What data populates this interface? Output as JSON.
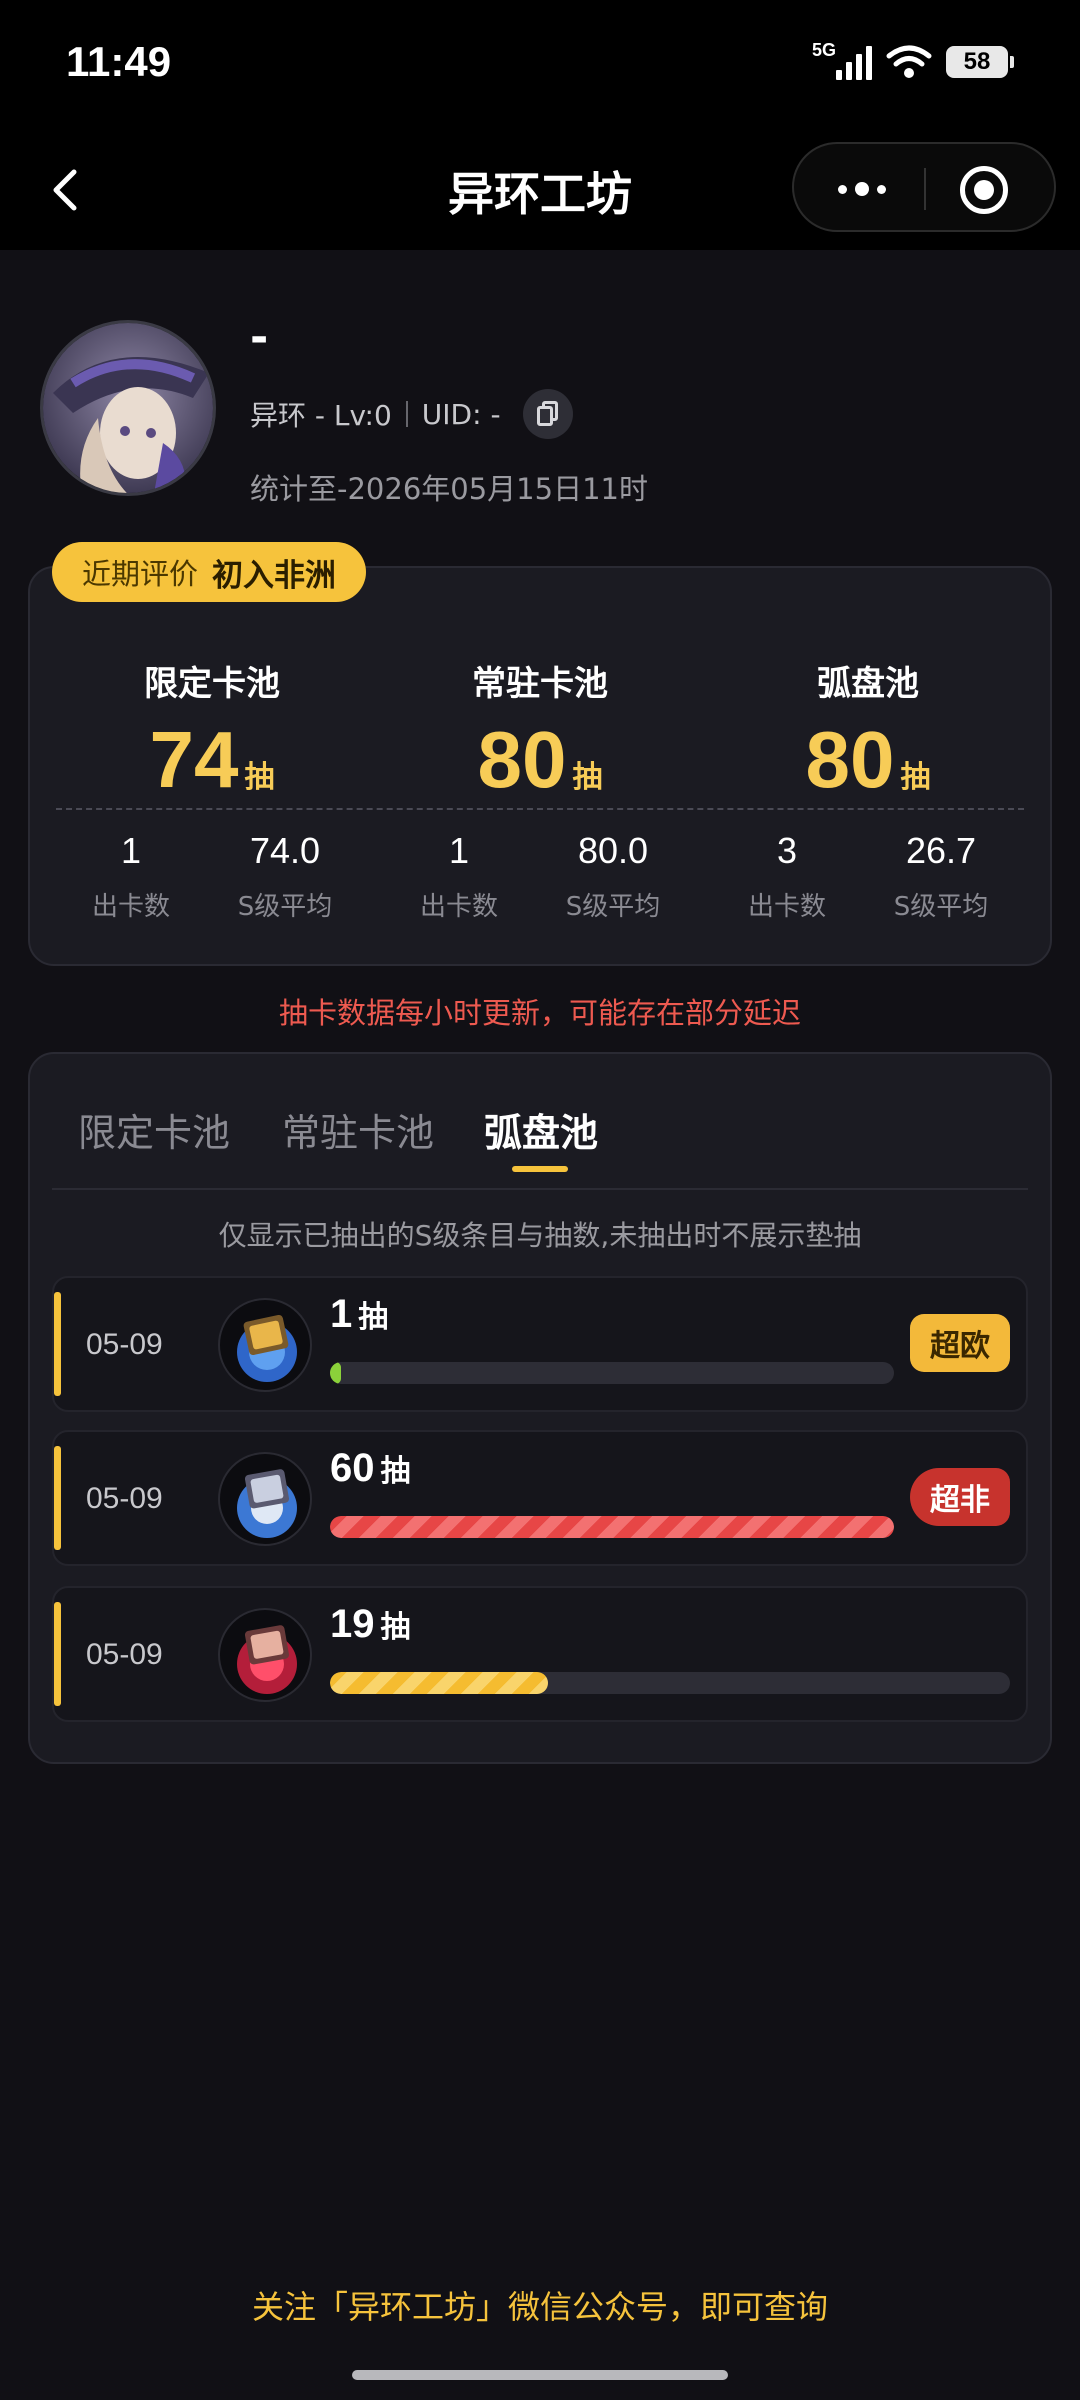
{
  "status_bar": {
    "time": "11:49",
    "network": "5G",
    "battery": "58"
  },
  "nav": {
    "title": "异环工坊"
  },
  "profile": {
    "name": "-",
    "game": "异环 - Lv:0",
    "uid": "UID: -",
    "stat_time": "统计至-2026年05月15日11时"
  },
  "rating": {
    "label": "近期评价",
    "value": "初入非洲"
  },
  "summary": {
    "unit": "抽",
    "pools": [
      {
        "name": "限定卡池",
        "pulls": "74",
        "count": "1",
        "count_label": "出卡数",
        "avg": "74.0",
        "avg_label": "S级平均"
      },
      {
        "name": "常驻卡池",
        "pulls": "80",
        "count": "1",
        "count_label": "出卡数",
        "avg": "80.0",
        "avg_label": "S级平均"
      },
      {
        "name": "弧盘池",
        "pulls": "80",
        "count": "3",
        "count_label": "出卡数",
        "avg": "26.7",
        "avg_label": "S级平均"
      }
    ]
  },
  "notice": "抽卡数据每小时更新，可能存在部分延迟",
  "tabs": [
    {
      "label": "限定卡池",
      "active": false
    },
    {
      "label": "常驻卡池",
      "active": false
    },
    {
      "label": "弧盘池",
      "active": true
    }
  ],
  "hint": "仅显示已抽出的S级条目与抽数,未抽出时不展示垫抽",
  "records": [
    {
      "date": "05-09",
      "pulls": "1",
      "unit": "抽",
      "fill_fraction": 0.02,
      "fill_color": "green",
      "badge": "超欧",
      "icon": "disc-item-icon",
      "icon_tint": "#3a7bd8"
    },
    {
      "date": "05-09",
      "pulls": "60",
      "unit": "抽",
      "fill_fraction": 1.0,
      "fill_color": "red",
      "badge": "超非",
      "icon": "disc-item-icon",
      "icon_tint": "#4a8de0"
    },
    {
      "date": "05-09",
      "pulls": "19",
      "unit": "抽",
      "fill_fraction": 0.32,
      "fill_color": "yellow",
      "badge": "",
      "icon": "disc-item-icon",
      "icon_tint": "#e0334a"
    }
  ],
  "footer": "关注「异环工坊」微信公众号，即可查询",
  "colors": {
    "accent": "#f6c33c",
    "danger": "#ee5a50",
    "background": "#111015",
    "card": "#1b1b22"
  }
}
